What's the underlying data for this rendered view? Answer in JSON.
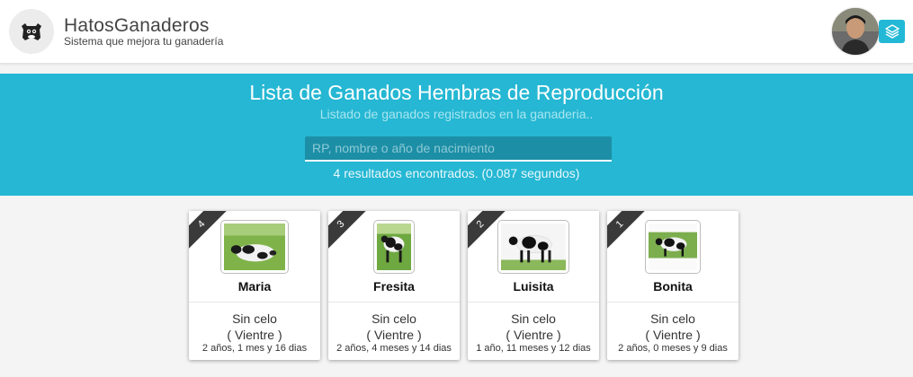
{
  "header": {
    "brand_title": "HatosGanaderos",
    "brand_subtitle": "Sistema que mejora tu ganadería",
    "logo_icon": "cow-icon",
    "layers_icon": "layers-icon",
    "accent_color": "#23b8d6"
  },
  "hero": {
    "title": "Lista de Ganados Hembras de Reproducción",
    "subtitle": "Listado de ganados registrados en la ganaderia..",
    "search_placeholder": "RP, nombre o año de nacimiento",
    "search_value": "",
    "result_text": "4 resultados encontrados. (0.087 segundos)"
  },
  "cards": [
    {
      "rank": "4",
      "name": "Maria",
      "status": "Sin celo",
      "category": "( Vientre )",
      "age": "2 años, 1 mes y 16 dias"
    },
    {
      "rank": "3",
      "name": "Fresita",
      "status": "Sin celo",
      "category": "( Vientre )",
      "age": "2 años, 4 meses y 14 dias"
    },
    {
      "rank": "2",
      "name": "Luisita",
      "status": "Sin celo",
      "category": "( Vientre )",
      "age": "1 año, 11 meses y 12 dias"
    },
    {
      "rank": "1",
      "name": "Bonita",
      "status": "Sin celo",
      "category": "( Vientre )",
      "age": "2 años, 0 meses y 9 dias"
    }
  ]
}
